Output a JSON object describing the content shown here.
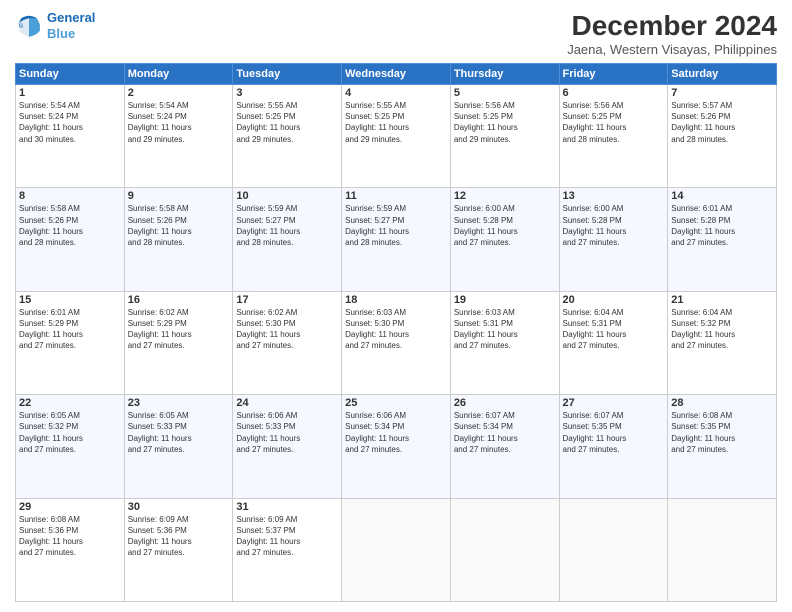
{
  "header": {
    "logo_line1": "General",
    "logo_line2": "Blue",
    "title": "December 2024",
    "subtitle": "Jaena, Western Visayas, Philippines"
  },
  "days_of_week": [
    "Sunday",
    "Monday",
    "Tuesday",
    "Wednesday",
    "Thursday",
    "Friday",
    "Saturday"
  ],
  "weeks": [
    [
      {
        "day": "1",
        "sunrise": "5:54 AM",
        "sunset": "5:24 PM",
        "daylight": "11 hours and 30 minutes."
      },
      {
        "day": "2",
        "sunrise": "5:54 AM",
        "sunset": "5:24 PM",
        "daylight": "11 hours and 29 minutes."
      },
      {
        "day": "3",
        "sunrise": "5:55 AM",
        "sunset": "5:25 PM",
        "daylight": "11 hours and 29 minutes."
      },
      {
        "day": "4",
        "sunrise": "5:55 AM",
        "sunset": "5:25 PM",
        "daylight": "11 hours and 29 minutes."
      },
      {
        "day": "5",
        "sunrise": "5:56 AM",
        "sunset": "5:25 PM",
        "daylight": "11 hours and 29 minutes."
      },
      {
        "day": "6",
        "sunrise": "5:56 AM",
        "sunset": "5:25 PM",
        "daylight": "11 hours and 28 minutes."
      },
      {
        "day": "7",
        "sunrise": "5:57 AM",
        "sunset": "5:26 PM",
        "daylight": "11 hours and 28 minutes."
      }
    ],
    [
      {
        "day": "8",
        "sunrise": "5:58 AM",
        "sunset": "5:26 PM",
        "daylight": "11 hours and 28 minutes."
      },
      {
        "day": "9",
        "sunrise": "5:58 AM",
        "sunset": "5:26 PM",
        "daylight": "11 hours and 28 minutes."
      },
      {
        "day": "10",
        "sunrise": "5:59 AM",
        "sunset": "5:27 PM",
        "daylight": "11 hours and 28 minutes."
      },
      {
        "day": "11",
        "sunrise": "5:59 AM",
        "sunset": "5:27 PM",
        "daylight": "11 hours and 28 minutes."
      },
      {
        "day": "12",
        "sunrise": "6:00 AM",
        "sunset": "5:28 PM",
        "daylight": "11 hours and 27 minutes."
      },
      {
        "day": "13",
        "sunrise": "6:00 AM",
        "sunset": "5:28 PM",
        "daylight": "11 hours and 27 minutes."
      },
      {
        "day": "14",
        "sunrise": "6:01 AM",
        "sunset": "5:28 PM",
        "daylight": "11 hours and 27 minutes."
      }
    ],
    [
      {
        "day": "15",
        "sunrise": "6:01 AM",
        "sunset": "5:29 PM",
        "daylight": "11 hours and 27 minutes."
      },
      {
        "day": "16",
        "sunrise": "6:02 AM",
        "sunset": "5:29 PM",
        "daylight": "11 hours and 27 minutes."
      },
      {
        "day": "17",
        "sunrise": "6:02 AM",
        "sunset": "5:30 PM",
        "daylight": "11 hours and 27 minutes."
      },
      {
        "day": "18",
        "sunrise": "6:03 AM",
        "sunset": "5:30 PM",
        "daylight": "11 hours and 27 minutes."
      },
      {
        "day": "19",
        "sunrise": "6:03 AM",
        "sunset": "5:31 PM",
        "daylight": "11 hours and 27 minutes."
      },
      {
        "day": "20",
        "sunrise": "6:04 AM",
        "sunset": "5:31 PM",
        "daylight": "11 hours and 27 minutes."
      },
      {
        "day": "21",
        "sunrise": "6:04 AM",
        "sunset": "5:32 PM",
        "daylight": "11 hours and 27 minutes."
      }
    ],
    [
      {
        "day": "22",
        "sunrise": "6:05 AM",
        "sunset": "5:32 PM",
        "daylight": "11 hours and 27 minutes."
      },
      {
        "day": "23",
        "sunrise": "6:05 AM",
        "sunset": "5:33 PM",
        "daylight": "11 hours and 27 minutes."
      },
      {
        "day": "24",
        "sunrise": "6:06 AM",
        "sunset": "5:33 PM",
        "daylight": "11 hours and 27 minutes."
      },
      {
        "day": "25",
        "sunrise": "6:06 AM",
        "sunset": "5:34 PM",
        "daylight": "11 hours and 27 minutes."
      },
      {
        "day": "26",
        "sunrise": "6:07 AM",
        "sunset": "5:34 PM",
        "daylight": "11 hours and 27 minutes."
      },
      {
        "day": "27",
        "sunrise": "6:07 AM",
        "sunset": "5:35 PM",
        "daylight": "11 hours and 27 minutes."
      },
      {
        "day": "28",
        "sunrise": "6:08 AM",
        "sunset": "5:35 PM",
        "daylight": "11 hours and 27 minutes."
      }
    ],
    [
      {
        "day": "29",
        "sunrise": "6:08 AM",
        "sunset": "5:36 PM",
        "daylight": "11 hours and 27 minutes."
      },
      {
        "day": "30",
        "sunrise": "6:09 AM",
        "sunset": "5:36 PM",
        "daylight": "11 hours and 27 minutes."
      },
      {
        "day": "31",
        "sunrise": "6:09 AM",
        "sunset": "5:37 PM",
        "daylight": "11 hours and 27 minutes."
      },
      null,
      null,
      null,
      null
    ]
  ],
  "labels": {
    "sunrise": "Sunrise: ",
    "sunset": "Sunset: ",
    "daylight": "Daylight: "
  }
}
